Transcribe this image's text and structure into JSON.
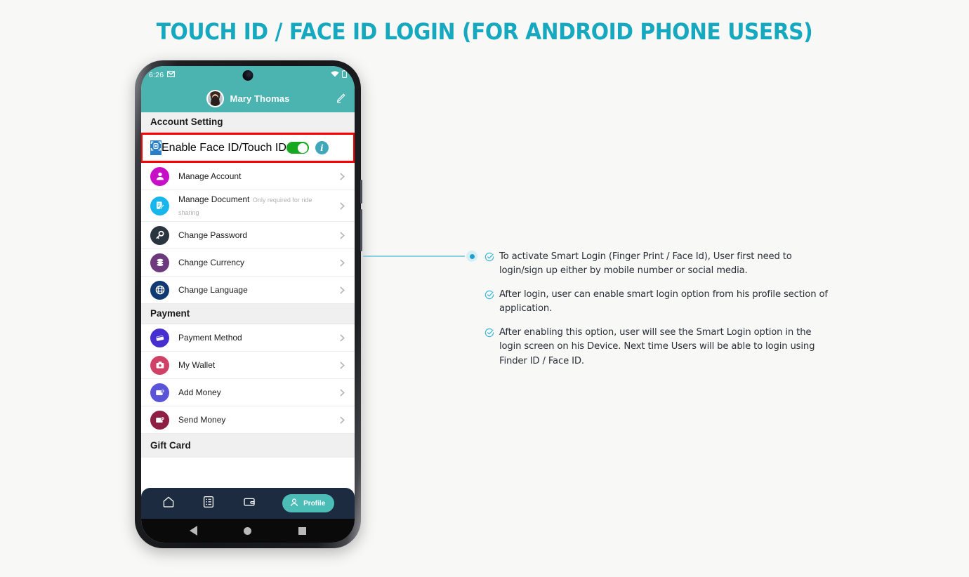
{
  "title": "TOUCH ID / FACE ID LOGIN (FOR ANDROID PHONE USERS)",
  "colors": {
    "title": "#16a8bf",
    "header_teal": "#4bb3b0",
    "highlight_red": "#ff0000",
    "toggle_on_green": "#16a81f",
    "nav_bar": "#1d2b41",
    "accent_pill": "#4bbdb6",
    "connector": "#89cfe0",
    "page_background": "#f8f8f7"
  },
  "phone": {
    "status_bar": {
      "time": "6:26",
      "gmail_icon": "gmail-icon",
      "camera": "punch-hole-camera",
      "wifi_icon": "wifi-icon",
      "battery_icon": "battery-icon"
    },
    "profile_header": {
      "name": "Mary Thomas",
      "avatar": "user-avatar",
      "edit_icon": "edit-pencil-icon"
    },
    "sections": [
      {
        "title": "Account Setting",
        "highlight_row": {
          "icon": "face-scan-icon",
          "icon_color": "#2b7fc4",
          "label": "Enable Face ID/Touch ID",
          "toggle_state": "on",
          "info_icon": "info-icon"
        },
        "rows": [
          {
            "icon": "person-icon",
            "icon_color": "#c70fc7",
            "label": "Manage Account",
            "sub": ""
          },
          {
            "icon": "document-edit-icon",
            "icon_color": "#18b6ec",
            "label": "Manage Document",
            "sub": "Only required for ride sharing"
          },
          {
            "icon": "key-icon",
            "icon_color": "#2b3540",
            "label": "Change Password",
            "sub": ""
          },
          {
            "icon": "coins-icon",
            "icon_color": "#6d3a7e",
            "label": "Change Currency",
            "sub": ""
          },
          {
            "icon": "globe-icon",
            "icon_color": "#113a72",
            "label": "Change Language",
            "sub": ""
          }
        ]
      },
      {
        "title": "Payment",
        "rows": [
          {
            "icon": "credit-cards-icon",
            "icon_color": "#4530cf",
            "label": "Payment Method",
            "sub": ""
          },
          {
            "icon": "wallet-icon",
            "icon_color": "#d04167",
            "label": "My Wallet",
            "sub": ""
          },
          {
            "icon": "add-money-icon",
            "icon_color": "#5a54d8",
            "label": "Add Money",
            "sub": ""
          },
          {
            "icon": "send-money-icon",
            "icon_color": "#8e1f44",
            "label": "Send Money",
            "sub": ""
          }
        ]
      },
      {
        "title": "Gift Card",
        "rows": []
      }
    ],
    "app_nav": {
      "items": [
        {
          "icon": "home-icon",
          "label": ""
        },
        {
          "icon": "list-checklist-icon",
          "label": ""
        },
        {
          "icon": "wallet-nav-icon",
          "label": ""
        }
      ],
      "active": {
        "icon": "profile-person-icon",
        "label": "Profile"
      }
    },
    "system_nav": {
      "back": "back-triangle-icon",
      "home": "home-circle-icon",
      "recents": "recents-square-icon"
    }
  },
  "callout": {
    "marker": "bullet-marker",
    "notes": [
      "To activate Smart Login (Finger Print / Face Id), User first need to login/sign up either by mobile number or social media.",
      "After login, user can enable smart login option from his profile section of application.",
      "After enabling this option, user will see the Smart Login option in the login screen on his Device. Next time Users will be able to login using Finder ID / Face ID."
    ]
  }
}
